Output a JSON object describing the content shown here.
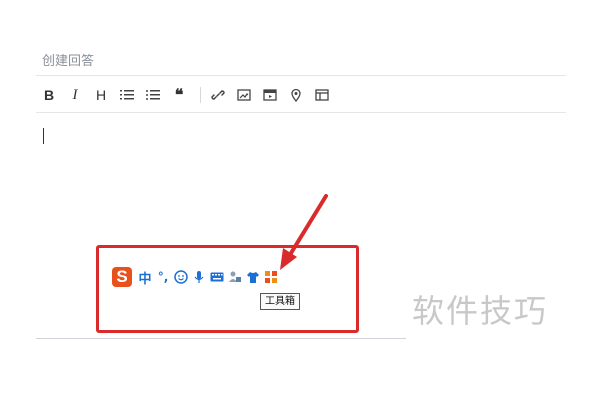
{
  "editor": {
    "title": "创建回答",
    "toolbar": {
      "bold": "B",
      "italic": "I",
      "heading": "H",
      "quote": "❝"
    }
  },
  "ime": {
    "logo": "S",
    "chinese_mode": "中",
    "punctuation": "°,",
    "toolbox_tooltip": "工具箱",
    "icons": [
      "emoji-icon",
      "mic-icon",
      "keyboard-icon",
      "user-icon",
      "skin-icon",
      "toolbox-icon"
    ]
  },
  "annotation": {
    "box_color": "#d92b2b",
    "arrow_color": "#d92b2b"
  },
  "watermark": "软件技巧"
}
